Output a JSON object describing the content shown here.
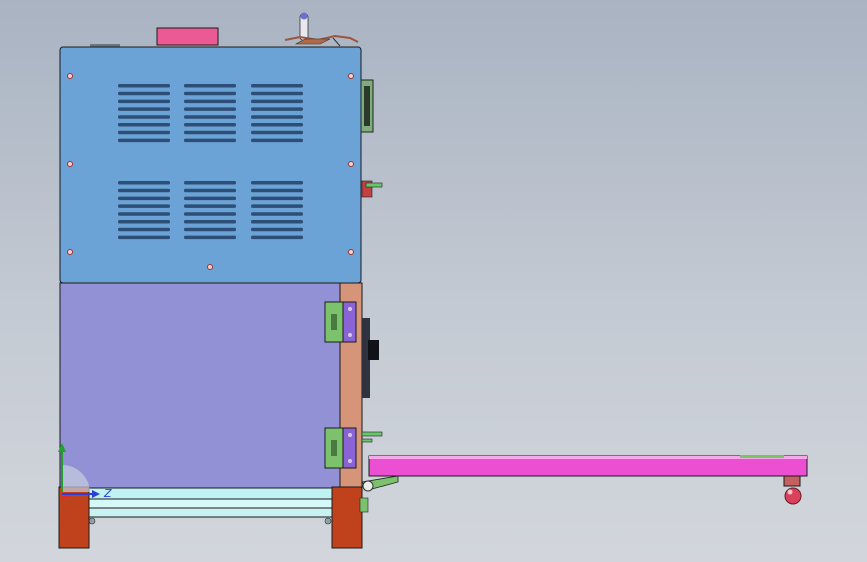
{
  "viewport": {
    "background_top": "#a9b3c2",
    "background_bottom": "#d2d6dc"
  },
  "model": {
    "colors": {
      "upper_cabinet": "#6ca3d6",
      "lower_cabinet": "#9291d6",
      "door_panel": "#d69478",
      "hinge_plate": "#7cc16b",
      "hinge_body": "#8a63d6",
      "feet": "#c0421c",
      "base_frame": "#bff2f2",
      "tray": "#ec4fd2",
      "top_label": "#ec5a96",
      "wheel": "#d8425c",
      "vent_slot": "#2d4e77"
    },
    "vent_groups": 6,
    "slots_per_group": 8,
    "hinges": 2,
    "feet_count": 2
  },
  "triad": {
    "axes": [
      {
        "name": "y-axis",
        "color": "#1fa12b"
      },
      {
        "name": "z-axis",
        "color": "#2a3ee0",
        "label": "Z"
      },
      {
        "name": "x-axis",
        "color": "#e02a2a"
      }
    ]
  }
}
